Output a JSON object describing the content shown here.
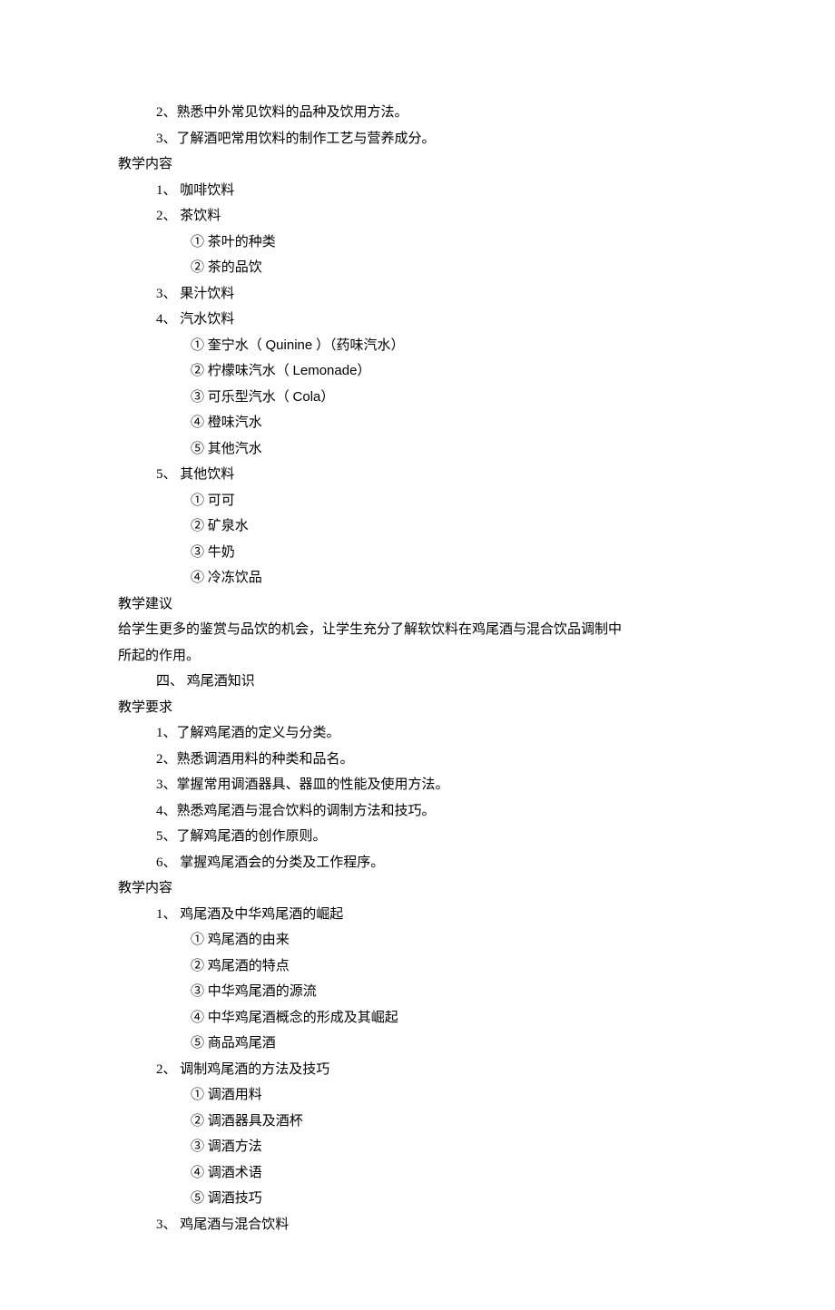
{
  "top": {
    "req2": "2、熟悉中外常见饮料的品种及饮用方法。",
    "req3": "3、了解酒吧常用饮料的制作工艺与营养成分。"
  },
  "content_section1": {
    "heading": "教学内容",
    "i1": "1、 咖啡饮料",
    "i2": "2、 茶饮料",
    "i2a": "①  茶叶的种类",
    "i2b": "②  茶的品饮",
    "i3": "3、 果汁饮料",
    "i4": "4、 汽水饮料",
    "i4a_pre": "①  奎宁水（ ",
    "i4a_latin": "Quinine",
    "i4a_post": " ）（药味汽水）",
    "i4b_pre": "②  柠檬味汽水（   ",
    "i4b_latin": "Lemonade",
    "i4b_post": "）",
    "i4c_pre": "③  可乐型汽水（   ",
    "i4c_latin": "Cola",
    "i4c_post": "）",
    "i4d": "④  橙味汽水",
    "i4e": "⑤  其他汽水",
    "i5": "5、 其他饮料",
    "i5a": "①  可可",
    "i5b": "②  矿泉水",
    "i5c": "③  牛奶",
    "i5d": "④  冷冻饮品"
  },
  "advice": {
    "heading": "教学建议",
    "line1": "        给学生更多的鉴赏与品饮的机会，让学生充分了解软饮料在鸡尾酒与混合饮品调制中",
    "line2": "所起的作用。"
  },
  "section4": {
    "title": "四、 鸡尾酒知识",
    "req_heading": "教学要求",
    "r1": "1、了解鸡尾酒的定义与分类。",
    "r2": "2、熟悉调酒用料的种类和品名。",
    "r3": "3、掌握常用调酒器具、器皿的性能及使用方法。",
    "r4": "4、熟悉鸡尾酒与混合饮料的调制方法和技巧。",
    "r5": "5、了解鸡尾酒的创作原则。",
    "r6": "6、 掌握鸡尾酒会的分类及工作程序。"
  },
  "content_section2": {
    "heading": "教学内容",
    "i1": "1、 鸡尾酒及中华鸡尾酒的崛起",
    "i1a": "①  鸡尾酒的由来",
    "i1b": "②  鸡尾酒的特点",
    "i1c": "③  中华鸡尾酒的源流",
    "i1d": "④  中华鸡尾酒概念的形成及其崛起",
    "i1e": "⑤  商品鸡尾酒",
    "i2": "2、 调制鸡尾酒的方法及技巧",
    "i2a": "①  调酒用料",
    "i2b": "②  调酒器具及酒杯",
    "i2c": "③  调酒方法",
    "i2d": "④  调酒术语",
    "i2e": "⑤  调酒技巧",
    "i3": "3、 鸡尾酒与混合饮料"
  }
}
